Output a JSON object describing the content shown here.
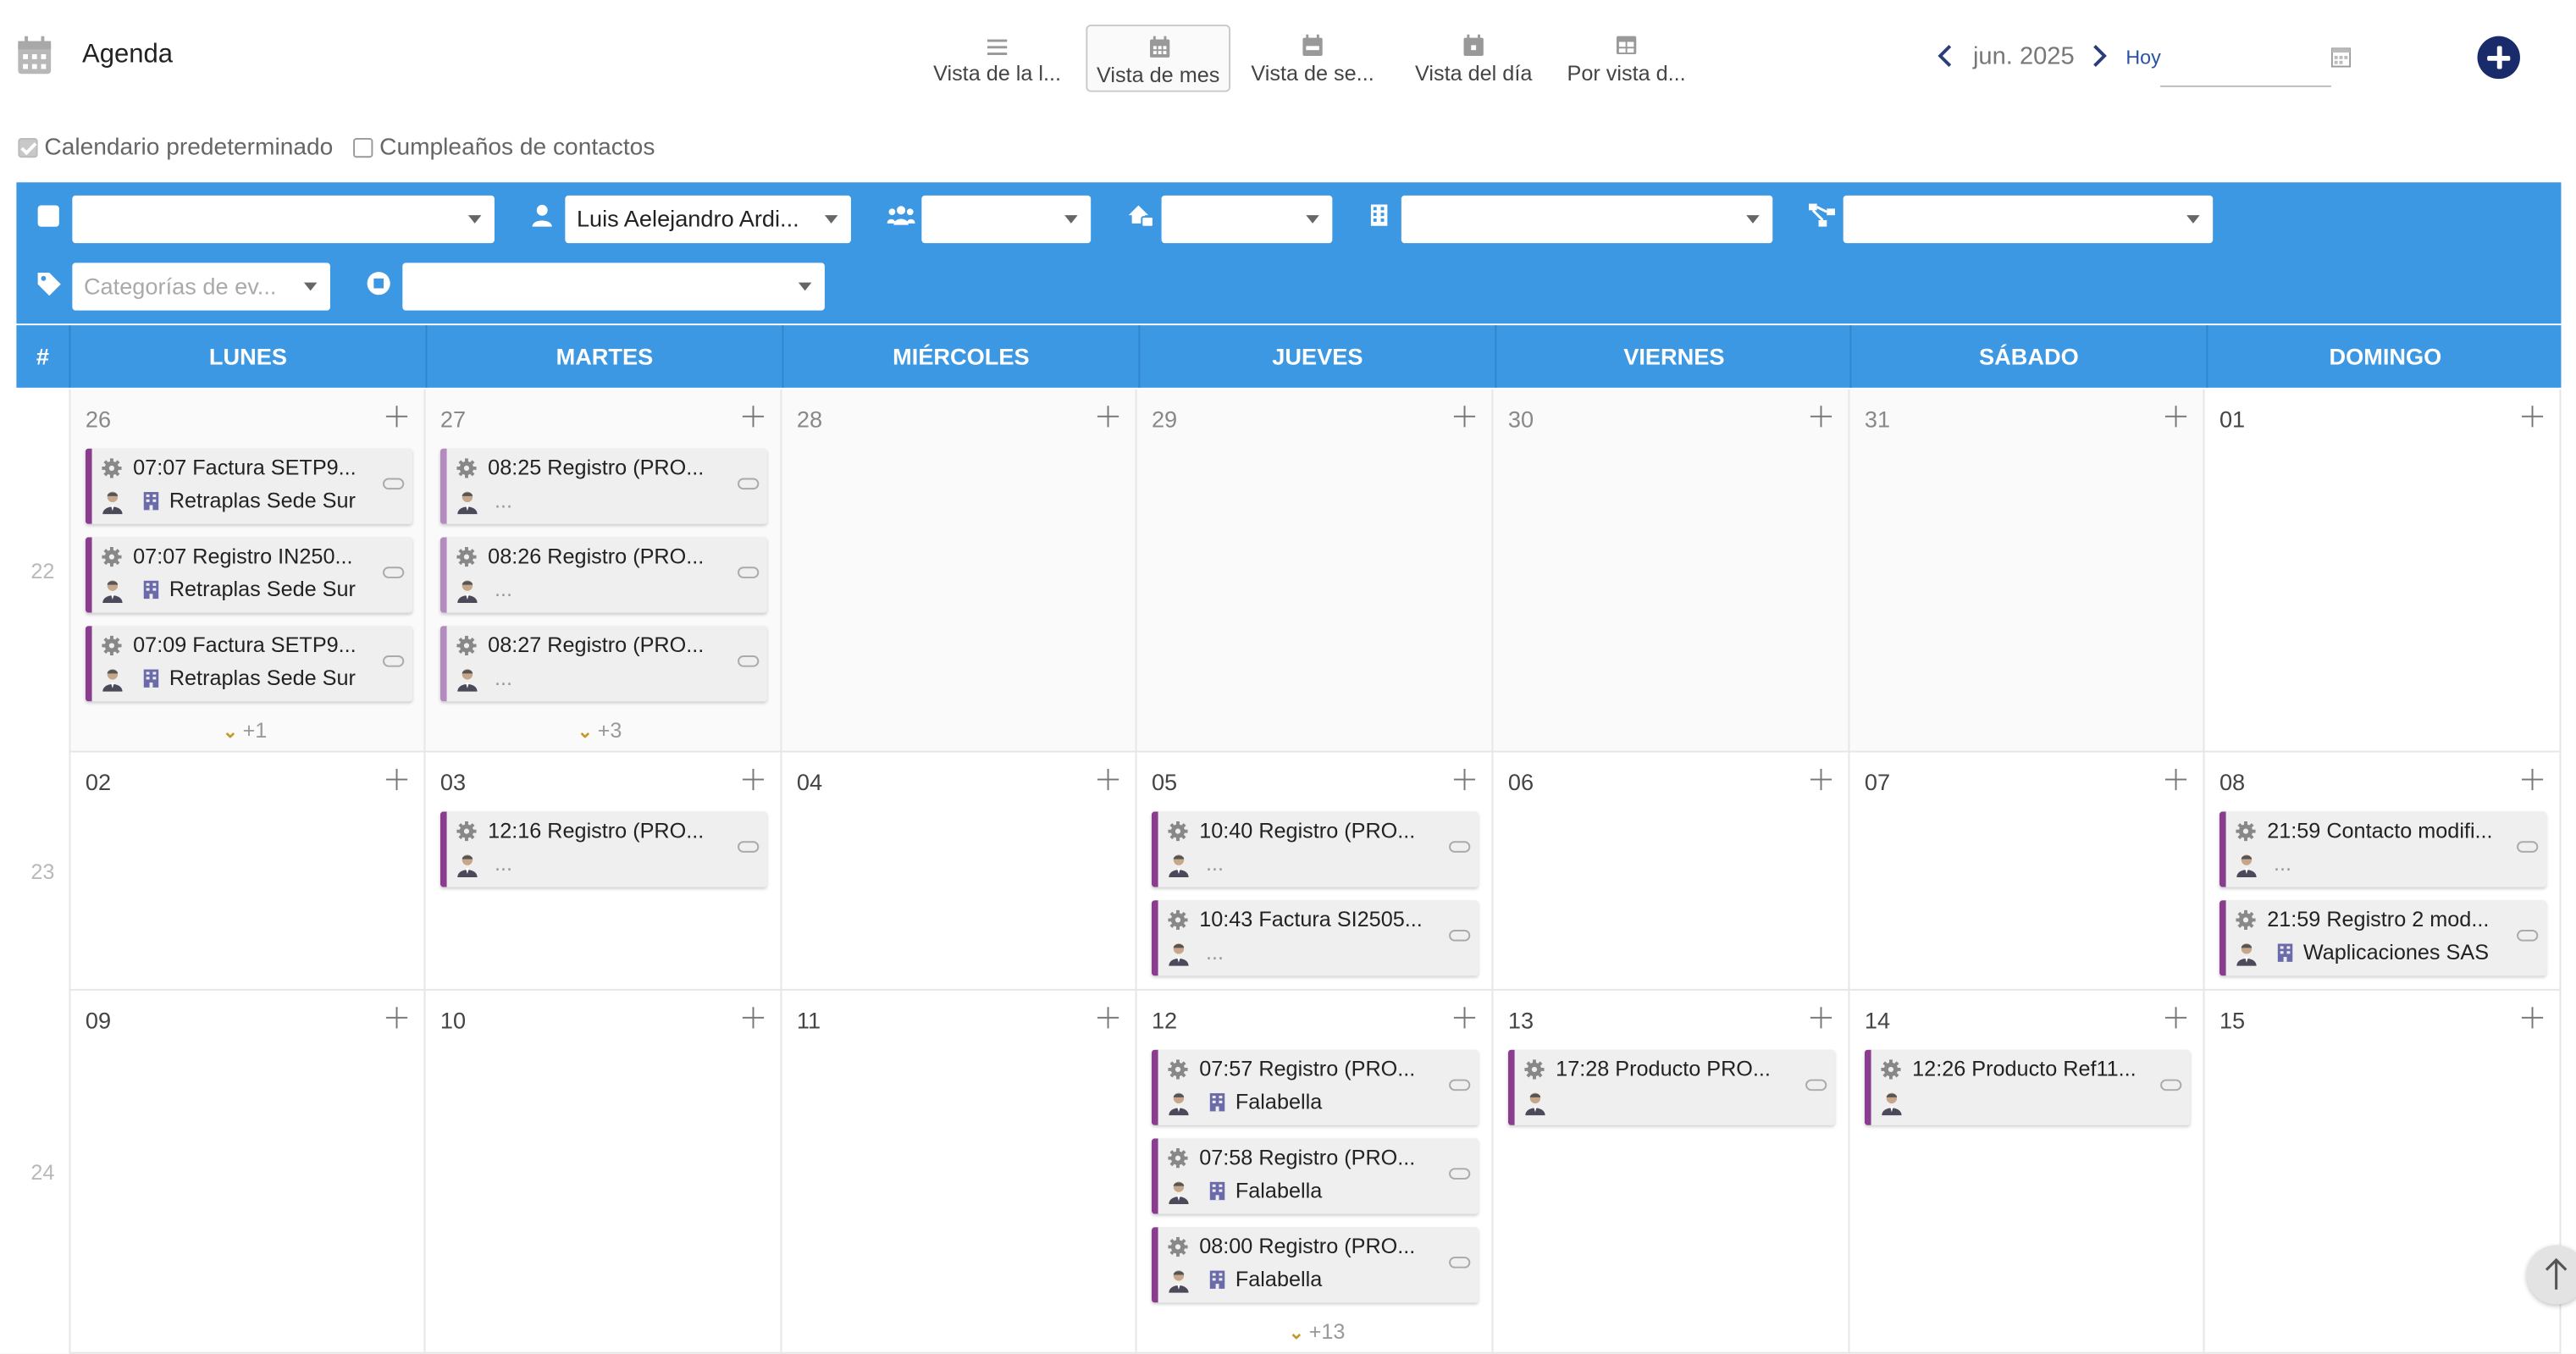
{
  "app": {
    "title": "Agenda"
  },
  "views": [
    {
      "label": "Vista de la l...",
      "icon": "list-icon",
      "active": false
    },
    {
      "label": "Vista de mes",
      "icon": "calendar-month-icon",
      "active": true
    },
    {
      "label": "Vista de se...",
      "icon": "calendar-week-icon",
      "active": false
    },
    {
      "label": "Vista del día",
      "icon": "calendar-day-icon",
      "active": false
    },
    {
      "label": "Por vista d...",
      "icon": "table-icon",
      "active": false
    }
  ],
  "nav": {
    "month": "jun. 2025",
    "today": "Hoy",
    "date_value": ""
  },
  "calendars": [
    {
      "label": "Calendario predeterminado",
      "checked": true
    },
    {
      "label": "Cumpleaños de contactos",
      "checked": false
    }
  ],
  "filters": {
    "type": "",
    "user": "Luis Aelejandro Ardi...",
    "group": "",
    "resource": "",
    "company": "",
    "project": "",
    "categories_placeholder": "Categorías de ev...",
    "status": ""
  },
  "grid": {
    "week_header": "#",
    "days": [
      "LUNES",
      "MARTES",
      "MIÉRCOLES",
      "JUEVES",
      "VIERNES",
      "SÁBADO",
      "DOMINGO"
    ],
    "weeks": [
      {
        "number": "22",
        "cells": [
          {
            "day": "26",
            "off": true,
            "events": [
              {
                "title": "07:07 Factura SETP9...",
                "sub": "Retraplas Sede Sur",
                "building": true,
                "light": false
              },
              {
                "title": "07:07 Registro IN250...",
                "sub": "Retraplas Sede Sur",
                "building": true,
                "light": false
              },
              {
                "title": "07:09 Factura SETP9...",
                "sub": "Retraplas Sede Sur",
                "building": true,
                "light": false
              }
            ],
            "more": "+1"
          },
          {
            "day": "27",
            "off": true,
            "events": [
              {
                "title": "08:25 Registro (PRO...",
                "sub": "...",
                "building": false,
                "light": true
              },
              {
                "title": "08:26 Registro (PRO...",
                "sub": "...",
                "building": false,
                "light": true
              },
              {
                "title": "08:27 Registro (PRO...",
                "sub": "...",
                "building": false,
                "light": true
              }
            ],
            "more": "+3"
          },
          {
            "day": "28",
            "off": true,
            "events": [],
            "more": ""
          },
          {
            "day": "29",
            "off": true,
            "events": [],
            "more": ""
          },
          {
            "day": "30",
            "off": true,
            "events": [],
            "more": ""
          },
          {
            "day": "31",
            "off": true,
            "events": [],
            "more": ""
          },
          {
            "day": "01",
            "off": false,
            "events": [],
            "more": ""
          }
        ]
      },
      {
        "number": "23",
        "cells": [
          {
            "day": "02",
            "off": false,
            "events": [],
            "more": ""
          },
          {
            "day": "03",
            "off": false,
            "events": [
              {
                "title": "12:16 Registro (PRO...",
                "sub": "...",
                "building": false,
                "light": false
              }
            ],
            "more": ""
          },
          {
            "day": "04",
            "off": false,
            "events": [],
            "more": ""
          },
          {
            "day": "05",
            "off": false,
            "events": [
              {
                "title": "10:40 Registro (PRO...",
                "sub": "...",
                "building": false,
                "light": false
              },
              {
                "title": "10:43 Factura SI2505...",
                "sub": "...",
                "building": false,
                "light": false
              }
            ],
            "more": ""
          },
          {
            "day": "06",
            "off": false,
            "events": [],
            "more": ""
          },
          {
            "day": "07",
            "off": false,
            "events": [],
            "more": ""
          },
          {
            "day": "08",
            "off": false,
            "events": [
              {
                "title": "21:59 Contacto modifi...",
                "sub": "...",
                "building": false,
                "light": false
              },
              {
                "title": "21:59 Registro 2 mod...",
                "sub": "Waplicaciones SAS",
                "building": true,
                "light": false
              }
            ],
            "more": ""
          }
        ]
      },
      {
        "number": "24",
        "cells": [
          {
            "day": "09",
            "off": false,
            "events": [],
            "more": ""
          },
          {
            "day": "10",
            "off": false,
            "events": [],
            "more": ""
          },
          {
            "day": "11",
            "off": false,
            "events": [],
            "more": ""
          },
          {
            "day": "12",
            "off": false,
            "events": [
              {
                "title": "07:57 Registro (PRO...",
                "sub": "Falabella",
                "building": true,
                "light": false
              },
              {
                "title": "07:58 Registro (PRO...",
                "sub": "Falabella",
                "building": true,
                "light": false
              },
              {
                "title": "08:00 Registro (PRO...",
                "sub": "Falabella",
                "building": true,
                "light": false
              }
            ],
            "more": "+13"
          },
          {
            "day": "13",
            "off": false,
            "events": [
              {
                "title": "17:28 Producto PRO...",
                "sub": "",
                "building": false,
                "light": false
              }
            ],
            "more": ""
          },
          {
            "day": "14",
            "off": false,
            "events": [
              {
                "title": "12:26 Producto Ref11...",
                "sub": "",
                "building": false,
                "light": false
              }
            ],
            "more": ""
          },
          {
            "day": "15",
            "off": false,
            "events": [],
            "more": ""
          }
        ]
      }
    ]
  },
  "colors": {
    "header_blue": "#3d98e3",
    "event_purple": "#8a3d8f",
    "event_purple_light": "#b48bbf",
    "add_button": "#1a2b6b",
    "more_chevron": "#c29a2a"
  }
}
